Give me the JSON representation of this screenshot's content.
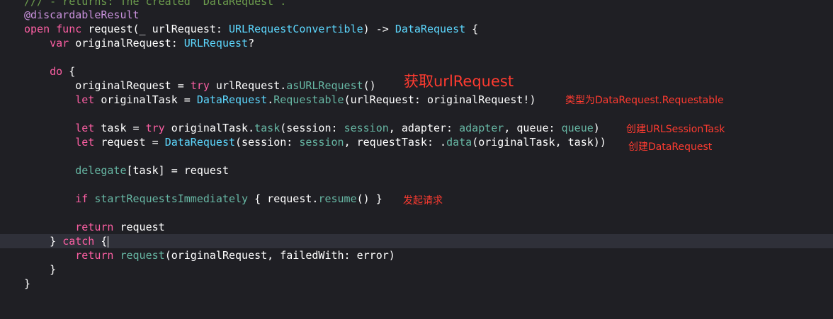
{
  "code": {
    "line0": "/// - returns: The created `DataRequest`.",
    "line1": "@discardableResult",
    "line2": {
      "open": "open",
      "func": "func",
      "name": "request",
      "params": "(_ urlRequest: ",
      "paramType": "URLRequestConvertible",
      "arrow": ") -> ",
      "retType": "DataRequest",
      "brace": " {"
    },
    "line3": {
      "var": "var",
      "name": " originalRequest: ",
      "type": "URLRequest",
      "opt": "?"
    },
    "line5": {
      "do": "do",
      "brace": " {"
    },
    "line6": {
      "lhs": "originalRequest = ",
      "try": "try",
      "mid": " urlRequest.",
      "call": "asURLRequest",
      "end": "()"
    },
    "line7": {
      "let": "let",
      "lhs": " originalTask = ",
      "type": "DataRequest",
      "dot": ".",
      "member": "Requestable",
      "args": "(urlRequest: originalRequest!)"
    },
    "line9": {
      "let": "let",
      "lhs": " task = ",
      "try": "try",
      "mid": " originalTask.",
      "call": "task",
      "a1": "(session: ",
      "v1": "session",
      "a2": ", adapter: ",
      "v2": "adapter",
      "a3": ", queue: ",
      "v3": "queue",
      "end": ")"
    },
    "line10": {
      "let": "let",
      "lhs": " request = ",
      "type": "DataRequest",
      "a1": "(session: ",
      "v1": "session",
      "a2": ", requestTask: .",
      "member": "data",
      "end": "(originalTask, task))"
    },
    "line12": {
      "delegate": "delegate",
      "rest": "[task] = request"
    },
    "line14": {
      "if": "if",
      "sp": " ",
      "cond": "startRequestsImmediately",
      "mid": " { request.",
      "call": "resume",
      "end": "() }"
    },
    "line16": {
      "return": "return",
      "rest": " request"
    },
    "line17": {
      "brace": "} ",
      "catch": "catch",
      "open": " {"
    },
    "line18": {
      "return": "return",
      "sp": " ",
      "call": "request",
      "rest": "(originalRequest, failedWith: error)"
    },
    "line19": "}",
    "line20": "}"
  },
  "annotations": {
    "get_url_request": "获取urlRequest",
    "type_is": "类型为DataRequest.Requestable",
    "create_task": "创建URLSessionTask",
    "create_request": "创建DataRequest",
    "send_request": "发起请求"
  },
  "colors": {
    "background": "#1f1f24",
    "current_line": "#2f3039",
    "keyword": "#fc5fa3",
    "type": "#5dd8ff",
    "function": "#67b7a4",
    "comment": "#6c9c4d",
    "attribute": "#c891db",
    "annotation": "#ff3b30"
  }
}
